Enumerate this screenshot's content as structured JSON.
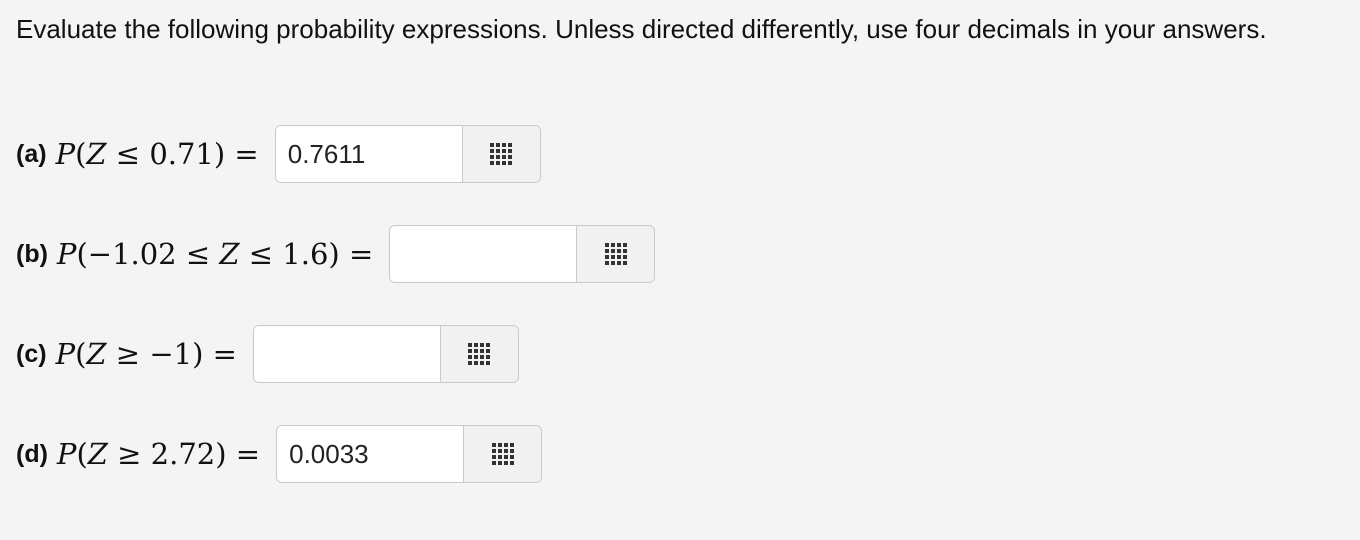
{
  "instructions": "Evaluate the following probability expressions. Unless directed differently, use four decimals in your answers.",
  "questions": [
    {
      "label": "(a)",
      "expr": {
        "p": "P",
        "open": "(",
        "left": "",
        "z": "Z",
        "rel": " ≤ ",
        "right": "0.71",
        "close": ")",
        "eq": " ="
      },
      "answer": "0.7611"
    },
    {
      "label": "(b)",
      "expr": {
        "p": "P",
        "open": "(",
        "left": "−1.02 ≤ ",
        "z": "Z",
        "rel": " ≤ ",
        "right": "1.6",
        "close": ")",
        "eq": " ="
      },
      "answer": ""
    },
    {
      "label": "(c)",
      "expr": {
        "p": "P",
        "open": "(",
        "left": "",
        "z": "Z",
        "rel": " ≥ ",
        "right": "−1",
        "close": ")",
        "eq": " ="
      },
      "answer": ""
    },
    {
      "label": "(d)",
      "expr": {
        "p": "P",
        "open": "(",
        "left": "",
        "z": "Z",
        "rel": " ≥ ",
        "right": "2.72",
        "close": ")",
        "eq": " ="
      },
      "answer": "0.0033"
    }
  ],
  "icons": {
    "keypad": "keypad-grid-icon"
  }
}
